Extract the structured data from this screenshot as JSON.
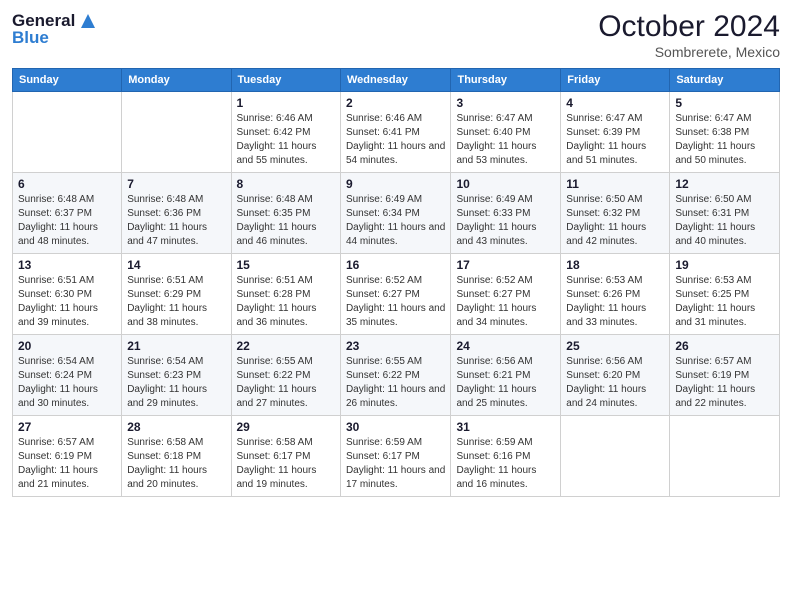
{
  "header": {
    "logo_line1": "General",
    "logo_line2": "Blue",
    "month": "October 2024",
    "location": "Sombrerete, Mexico"
  },
  "weekdays": [
    "Sunday",
    "Monday",
    "Tuesday",
    "Wednesday",
    "Thursday",
    "Friday",
    "Saturday"
  ],
  "weeks": [
    [
      {
        "day": "",
        "info": ""
      },
      {
        "day": "",
        "info": ""
      },
      {
        "day": "1",
        "info": "Sunrise: 6:46 AM\nSunset: 6:42 PM\nDaylight: 11 hours and 55 minutes."
      },
      {
        "day": "2",
        "info": "Sunrise: 6:46 AM\nSunset: 6:41 PM\nDaylight: 11 hours and 54 minutes."
      },
      {
        "day": "3",
        "info": "Sunrise: 6:47 AM\nSunset: 6:40 PM\nDaylight: 11 hours and 53 minutes."
      },
      {
        "day": "4",
        "info": "Sunrise: 6:47 AM\nSunset: 6:39 PM\nDaylight: 11 hours and 51 minutes."
      },
      {
        "day": "5",
        "info": "Sunrise: 6:47 AM\nSunset: 6:38 PM\nDaylight: 11 hours and 50 minutes."
      }
    ],
    [
      {
        "day": "6",
        "info": "Sunrise: 6:48 AM\nSunset: 6:37 PM\nDaylight: 11 hours and 48 minutes."
      },
      {
        "day": "7",
        "info": "Sunrise: 6:48 AM\nSunset: 6:36 PM\nDaylight: 11 hours and 47 minutes."
      },
      {
        "day": "8",
        "info": "Sunrise: 6:48 AM\nSunset: 6:35 PM\nDaylight: 11 hours and 46 minutes."
      },
      {
        "day": "9",
        "info": "Sunrise: 6:49 AM\nSunset: 6:34 PM\nDaylight: 11 hours and 44 minutes."
      },
      {
        "day": "10",
        "info": "Sunrise: 6:49 AM\nSunset: 6:33 PM\nDaylight: 11 hours and 43 minutes."
      },
      {
        "day": "11",
        "info": "Sunrise: 6:50 AM\nSunset: 6:32 PM\nDaylight: 11 hours and 42 minutes."
      },
      {
        "day": "12",
        "info": "Sunrise: 6:50 AM\nSunset: 6:31 PM\nDaylight: 11 hours and 40 minutes."
      }
    ],
    [
      {
        "day": "13",
        "info": "Sunrise: 6:51 AM\nSunset: 6:30 PM\nDaylight: 11 hours and 39 minutes."
      },
      {
        "day": "14",
        "info": "Sunrise: 6:51 AM\nSunset: 6:29 PM\nDaylight: 11 hours and 38 minutes."
      },
      {
        "day": "15",
        "info": "Sunrise: 6:51 AM\nSunset: 6:28 PM\nDaylight: 11 hours and 36 minutes."
      },
      {
        "day": "16",
        "info": "Sunrise: 6:52 AM\nSunset: 6:27 PM\nDaylight: 11 hours and 35 minutes."
      },
      {
        "day": "17",
        "info": "Sunrise: 6:52 AM\nSunset: 6:27 PM\nDaylight: 11 hours and 34 minutes."
      },
      {
        "day": "18",
        "info": "Sunrise: 6:53 AM\nSunset: 6:26 PM\nDaylight: 11 hours and 33 minutes."
      },
      {
        "day": "19",
        "info": "Sunrise: 6:53 AM\nSunset: 6:25 PM\nDaylight: 11 hours and 31 minutes."
      }
    ],
    [
      {
        "day": "20",
        "info": "Sunrise: 6:54 AM\nSunset: 6:24 PM\nDaylight: 11 hours and 30 minutes."
      },
      {
        "day": "21",
        "info": "Sunrise: 6:54 AM\nSunset: 6:23 PM\nDaylight: 11 hours and 29 minutes."
      },
      {
        "day": "22",
        "info": "Sunrise: 6:55 AM\nSunset: 6:22 PM\nDaylight: 11 hours and 27 minutes."
      },
      {
        "day": "23",
        "info": "Sunrise: 6:55 AM\nSunset: 6:22 PM\nDaylight: 11 hours and 26 minutes."
      },
      {
        "day": "24",
        "info": "Sunrise: 6:56 AM\nSunset: 6:21 PM\nDaylight: 11 hours and 25 minutes."
      },
      {
        "day": "25",
        "info": "Sunrise: 6:56 AM\nSunset: 6:20 PM\nDaylight: 11 hours and 24 minutes."
      },
      {
        "day": "26",
        "info": "Sunrise: 6:57 AM\nSunset: 6:19 PM\nDaylight: 11 hours and 22 minutes."
      }
    ],
    [
      {
        "day": "27",
        "info": "Sunrise: 6:57 AM\nSunset: 6:19 PM\nDaylight: 11 hours and 21 minutes."
      },
      {
        "day": "28",
        "info": "Sunrise: 6:58 AM\nSunset: 6:18 PM\nDaylight: 11 hours and 20 minutes."
      },
      {
        "day": "29",
        "info": "Sunrise: 6:58 AM\nSunset: 6:17 PM\nDaylight: 11 hours and 19 minutes."
      },
      {
        "day": "30",
        "info": "Sunrise: 6:59 AM\nSunset: 6:17 PM\nDaylight: 11 hours and 17 minutes."
      },
      {
        "day": "31",
        "info": "Sunrise: 6:59 AM\nSunset: 6:16 PM\nDaylight: 11 hours and 16 minutes."
      },
      {
        "day": "",
        "info": ""
      },
      {
        "day": "",
        "info": ""
      }
    ]
  ]
}
